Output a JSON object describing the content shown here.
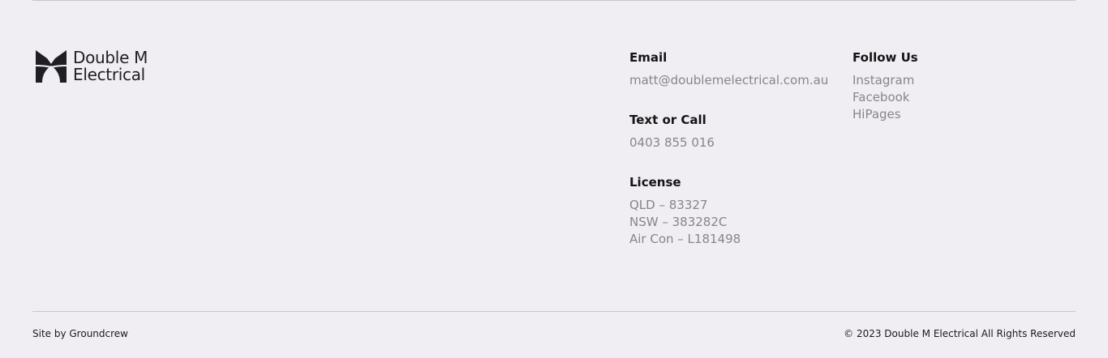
{
  "brand": {
    "name_line1": "Double M",
    "name_line2": "Electrical",
    "logo_icon": "double-m-logo-icon"
  },
  "contact": {
    "email": {
      "heading": "Email",
      "value": "matt@doublemelectrical.com.au"
    },
    "phone": {
      "heading": "Text or Call",
      "value": "0403 855 016"
    },
    "license": {
      "heading": "License",
      "lines": [
        "QLD – 83327",
        "NSW – 383282C",
        "Air Con – L181498"
      ]
    }
  },
  "social": {
    "heading": "Follow Us",
    "links": [
      "Instagram",
      "Facebook",
      "HiPages"
    ]
  },
  "footer": {
    "credit": "Site by Groundcrew",
    "copyright": "© 2023 Double M Electrical All Rights Reserved"
  },
  "colors": {
    "background": "#f0eef3",
    "heading": "#141414",
    "muted_text": "#86858a",
    "rule": "#c9c7cc"
  }
}
